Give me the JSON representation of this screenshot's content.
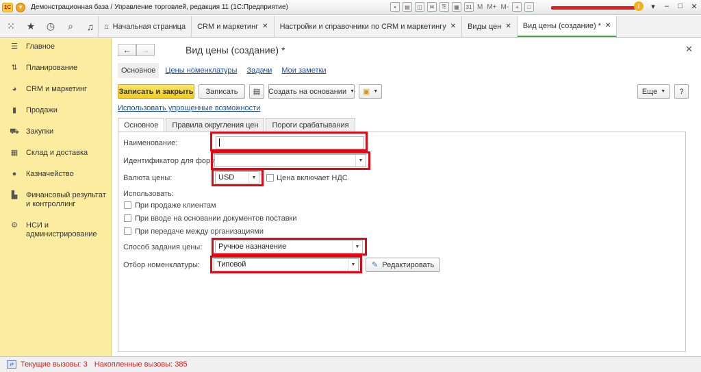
{
  "window": {
    "title": "Демонстрационная база / Управление торговлей, редакция 11  (1С:Предприятие)",
    "logo": "1С",
    "mem_labels": [
      "M",
      "M+",
      "M-"
    ]
  },
  "tabs": [
    {
      "label": "Начальная страница",
      "closable": false
    },
    {
      "label": "CRM и маркетинг",
      "closable": true
    },
    {
      "label": "Настройки и справочники по CRM и маркетингу",
      "closable": true
    },
    {
      "label": "Виды цен",
      "closable": true
    },
    {
      "label": "Вид цены (создание) *",
      "closable": true,
      "active": true
    }
  ],
  "sidebar": {
    "items": [
      {
        "label": "Главное",
        "icon": "menu-icon"
      },
      {
        "label": "Планирование",
        "icon": "planning-icon"
      },
      {
        "label": "CRM и маркетинг",
        "icon": "pie-chart-icon"
      },
      {
        "label": "Продажи",
        "icon": "sales-bag-icon"
      },
      {
        "label": "Закупки",
        "icon": "cart-icon"
      },
      {
        "label": "Склад и доставка",
        "icon": "warehouse-icon"
      },
      {
        "label": "Казначейство",
        "icon": "coin-icon"
      },
      {
        "label": "Финансовый результат и контроллинг",
        "icon": "bar-chart-icon"
      },
      {
        "label": "НСИ и администрирование",
        "icon": "gear-icon"
      }
    ]
  },
  "form": {
    "title": "Вид цены (создание) *",
    "sections": [
      "Основное",
      "Цены номенклатуры",
      "Задачи",
      "Мои заметки"
    ],
    "commands": {
      "save_close": "Записать и закрыть",
      "save": "Записать",
      "create_based": "Создать на основании",
      "more": "Еще",
      "help": "?"
    },
    "simplified_link": "Использовать упрощенные возможности",
    "tabs": [
      "Основное",
      "Правила округления цен",
      "Пороги срабатывания"
    ],
    "fields": {
      "name_label": "Наименование:",
      "name_value": "",
      "formula_id_label": "Идентификатор для формул",
      "formula_id_value": "",
      "currency_label": "Валюта цены:",
      "currency_value": "USD",
      "vat_label": "Цена включает НДС",
      "use_label": "Использовать:",
      "use_options": [
        "При продаже клиентам",
        "При вводе на основании документов поставки",
        "При передаче между организациями"
      ],
      "price_method_label": "Способ задания цены:",
      "price_method_value": "Ручное назначение",
      "nomenclature_label": "Отбор номенклатуры:",
      "nomenclature_value": "Типовой",
      "edit_button": "Редактировать"
    }
  },
  "status": {
    "current_calls": "Текущие вызовы: 3",
    "accumulated_calls": "Накопленные вызовы: 385"
  },
  "colors": {
    "sidebar_bg": "#fbeca0",
    "primary_button": "#f2cc17",
    "highlight": "#e30613",
    "link": "#1a4ea0",
    "status_text": "#d42020"
  }
}
